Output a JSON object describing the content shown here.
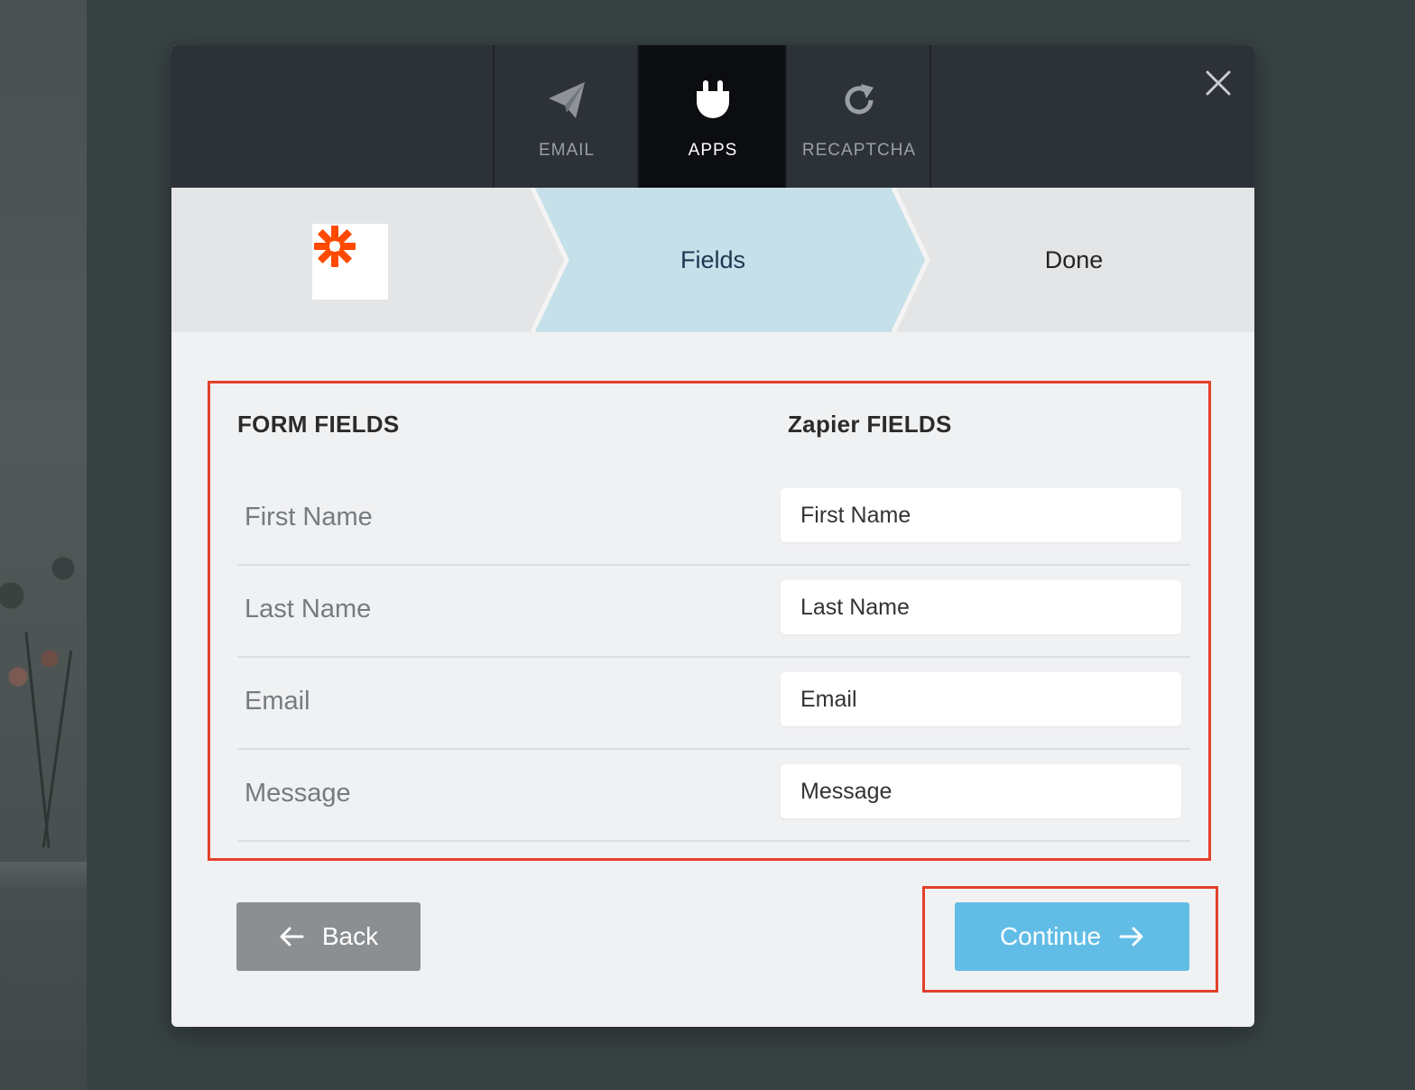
{
  "tabs": [
    {
      "label": "EMAIL",
      "icon": "paper-plane-icon",
      "active": false
    },
    {
      "label": "APPS",
      "icon": "plug-icon",
      "active": true
    },
    {
      "label": "RECAPTCHA",
      "icon": "refresh-icon",
      "active": false
    }
  ],
  "stepper": {
    "logo_icon": "zapier-logo-icon",
    "steps": [
      {
        "label": "Fields",
        "active": true
      },
      {
        "label": "Done",
        "active": false
      }
    ]
  },
  "mapping": {
    "form_header": "FORM FIELDS",
    "zapier_header": "Zapier FIELDS",
    "rows": [
      {
        "form_field": "First Name",
        "zapier_value": "First Name"
      },
      {
        "form_field": "Last Name",
        "zapier_value": "Last Name"
      },
      {
        "form_field": "Email",
        "zapier_value": "Email"
      },
      {
        "form_field": "Message",
        "zapier_value": "Message"
      }
    ]
  },
  "buttons": {
    "back_label": "Back",
    "continue_label": "Continue"
  },
  "colors": {
    "accent": "#62bde6",
    "highlight": "#e2412b",
    "zapier_orange": "#ff4a00",
    "topbar": "#2d3138"
  }
}
